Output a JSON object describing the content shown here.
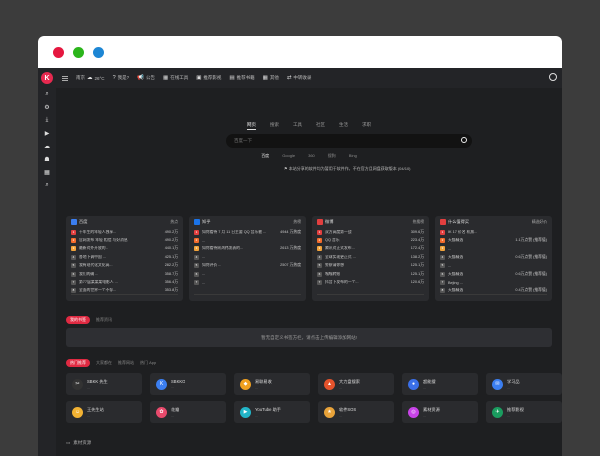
{
  "window": {
    "controls": [
      "close",
      "minimize",
      "maximize"
    ]
  },
  "topnav": {
    "logo_letter": "K",
    "weather_city": "南京",
    "weather_temp": "26°C",
    "items": [
      {
        "icon": "question-icon",
        "label": "我是?"
      },
      {
        "icon": "megaphone-icon",
        "label": "公告"
      },
      {
        "icon": "tool-icon",
        "label": "在线工具"
      },
      {
        "icon": "film-icon",
        "label": "推荐影视"
      },
      {
        "icon": "book-icon",
        "label": "推荐书籍"
      },
      {
        "icon": "grid-icon",
        "label": "其他"
      },
      {
        "icon": "share-icon",
        "label": "中转收录"
      }
    ]
  },
  "sidebar": {
    "icons": [
      "search-icon",
      "settings-icon",
      "download-icon",
      "video-icon",
      "cloud-icon",
      "robot-icon",
      "grid-icon",
      "search-doc-icon"
    ]
  },
  "search": {
    "tabs": [
      "网页",
      "搜索",
      "工具",
      "社区",
      "生活",
      "求职"
    ],
    "active_tab": 0,
    "placeholder": "百度一下",
    "engines": [
      "百度",
      "Google",
      "360",
      "搜狗",
      "Bing"
    ],
    "active_engine": 0,
    "notice": "本站分享的软件均为暂用于软件作，不在官方且网盘获取版本 (04/10)"
  },
  "hot_cards": [
    {
      "name": "百度",
      "subtitle": "热点",
      "color": "#3b7ef0",
      "rows": [
        {
          "text": "十年生的年轻人独享...",
          "value": "490.2万"
        },
        {
          "text": "官网发布 年轻 相信 与好消息",
          "value": "490.2万"
        },
        {
          "text": "最新对外开放的..",
          "value": "440.1万"
        },
        {
          "text": "各地下调中国 ...",
          "value": "425.1万"
        },
        {
          "text": "我有现代化文化高...",
          "value": "282.2万"
        },
        {
          "text": "我们的确 ...",
          "value": "358.7万"
        },
        {
          "text": "第77届某某某电影人 ...",
          "value": "356.4万"
        },
        {
          "text": "全面的世界一个不存...",
          "value": "353.8万"
        }
      ]
    },
    {
      "name": "知乎",
      "subtitle": "热榜",
      "color": "#1a73e8",
      "rows": [
        {
          "text": "如何看待 7 月 11 日主要 QQ 音乐被 ...",
          "value": "4944 万热度"
        },
        {
          "text": "...",
          "value": ""
        },
        {
          "text": "如何看待周鸿祎发表的...",
          "value": "2613 万热度"
        },
        {
          "text": "...",
          "value": ""
        },
        {
          "text": "如何评价 ...",
          "value": "2507 万热度"
        },
        {
          "text": "...",
          "value": ""
        },
        {
          "text": "...",
          "value": ""
        }
      ]
    },
    {
      "name": "微博",
      "subtitle": "热搜榜",
      "color": "#e23f3f",
      "rows": [
        {
          "text": "双方高度第一战",
          "value": "309.6万"
        },
        {
          "text": "QQ 音乐",
          "value": "223.4万"
        },
        {
          "text": "腾讯对正式发布...",
          "value": "172.4万"
        },
        {
          "text": "全球实现更正式 ...",
          "value": "138.2万"
        },
        {
          "text": "警察请你想",
          "value": "125.1万"
        },
        {
          "text": "嘎嘎转账",
          "value": "125.1万"
        },
        {
          "text": "抖音下发布的一个...",
          "value": "120.6万"
        }
      ]
    },
    {
      "name": "什么值得买",
      "subtitle": "精选好价",
      "color": "#e23f3f",
      "rows": [
        {
          "text": "IK 17 价名 机票...",
          "value": ""
        },
        {
          "text": "天猫精选",
          "value": "1.1万点赞 (推荐值)"
        },
        {
          "text": "...",
          "value": ""
        },
        {
          "text": "天猫精选",
          "value": "0.6万点赞 (推荐值)"
        },
        {
          "text": "...",
          "value": ""
        },
        {
          "text": "天猫精选",
          "value": "0.6万点赞 (推荐值)"
        },
        {
          "text": "Bejing ...",
          "value": ""
        },
        {
          "text": "天猫精选",
          "value": "0.4万点赞 (推荐值)"
        }
      ]
    }
  ],
  "mid_tabs": [
    "我的书签",
    "推荐资讯"
  ],
  "mid_active": 0,
  "banner_text": "暂无自定义书签方栏，请点击上传编辑添加网站!",
  "app_tabs": [
    "热门推荐",
    "大家都在",
    "推荐网站",
    "热门 App"
  ],
  "app_active": 0,
  "apps": [
    {
      "name": "SBKK 先生",
      "desc": "...",
      "icon_color": "#333",
      "glyph": "✂"
    },
    {
      "name": "SBKKO",
      "desc": "...",
      "icon_color": "#3b7ef0",
      "glyph": "K"
    },
    {
      "name": "易联易收",
      "desc": "...",
      "icon_color": "#f0a020",
      "glyph": "◆"
    },
    {
      "name": "大力盘搜索",
      "desc": "...",
      "icon_color": "#e5532c",
      "glyph": "▲"
    },
    {
      "name": "超能搜",
      "desc": "...",
      "icon_color": "#3a6fe8",
      "glyph": "●"
    },
    {
      "name": "学习品",
      "desc": "...",
      "icon_color": "#3b7ef0",
      "glyph": "✉"
    },
    {
      "name": "王先生站",
      "desc": "...",
      "icon_color": "#f2b233",
      "glyph": "☺"
    },
    {
      "name": "花瓣",
      "desc": "...",
      "icon_color": "#e84a6c",
      "glyph": "✿"
    },
    {
      "name": "YouTube 助手",
      "desc": "...",
      "icon_color": "#22b5c8",
      "glyph": "▶"
    },
    {
      "name": "软件SOS",
      "desc": "...",
      "icon_color": "#e8a33a",
      "glyph": "★"
    },
    {
      "name": "素材资源",
      "desc": "...",
      "icon_color": "#c843e8",
      "glyph": "◎"
    },
    {
      "name": "推荐影视",
      "desc": "...",
      "icon_color": "#1a9c5f",
      "glyph": "✈"
    }
  ],
  "bottom_title": "素材资源"
}
